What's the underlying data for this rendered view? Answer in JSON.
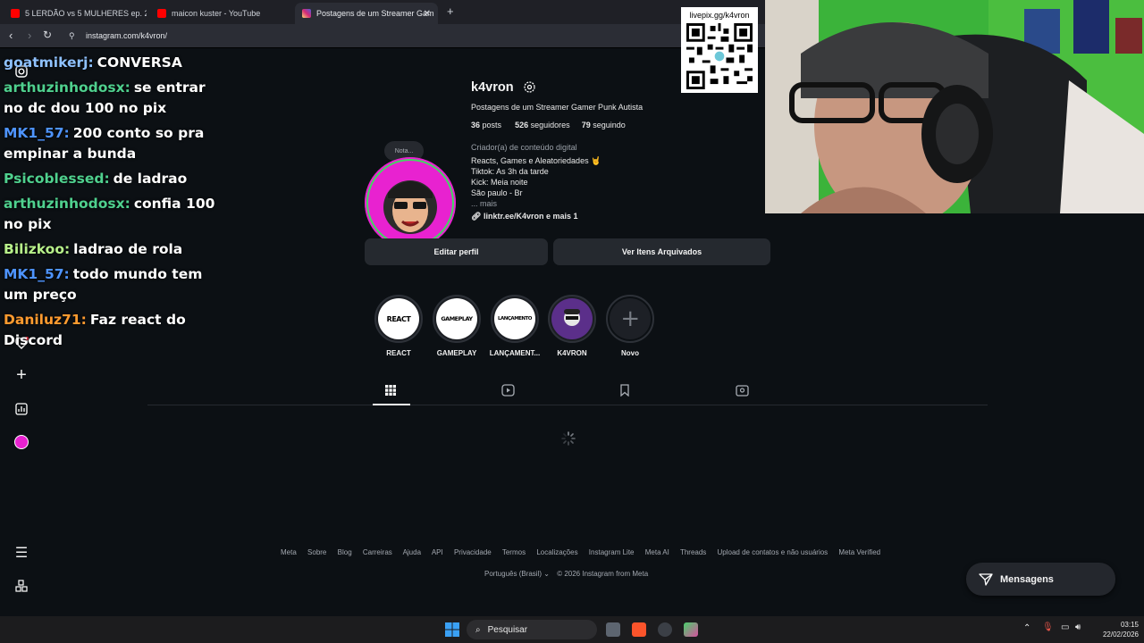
{
  "browser": {
    "tabs": [
      {
        "title": "5 LERDÃO vs 5 MULHERES ep. 2 - You",
        "icon": "youtube-icon",
        "color": "#ff0000"
      },
      {
        "title": "maicon kuster - YouTube",
        "icon": "youtube-icon",
        "color": "#ff0000"
      },
      {
        "title": "Postagens de um Streamer Gam",
        "icon": "instagram-icon",
        "color": "#dd2a7b"
      }
    ],
    "url": "instagram.com/k4vron/"
  },
  "chat": [
    {
      "user": "goatmikerj:",
      "message": "CONVERSA",
      "color": "#8fc2ff"
    },
    {
      "user": "arthuzinhodosx:",
      "message": "se entrar no dc dou 100 no pix",
      "color": "#4fd08e"
    },
    {
      "user": "MK1_57:",
      "message": "200 conto so pra empinar a bunda",
      "color": "#4e94ff"
    },
    {
      "user": "Psicoblessed:",
      "message": "de ladrao",
      "color": "#4fd08e"
    },
    {
      "user": "arthuzinhodosx:",
      "message": "confia 100 no pix",
      "color": "#4fd08e"
    },
    {
      "user": "Bilizkoo:",
      "message": "ladrao de rola",
      "color": "#b7f08a"
    },
    {
      "user": "MK1_57:",
      "message": "todo mundo tem um preço",
      "color": "#4e94ff"
    },
    {
      "user": "Daniluz71:",
      "message": "Faz react do Discord",
      "color": "#ff9b2f"
    }
  ],
  "profile": {
    "note": "Nota...",
    "username": "k4vron",
    "bio_title": "Postagens de um Streamer Gamer Punk Autista",
    "stats": {
      "posts": "36",
      "posts_label": "posts",
      "followers": "526",
      "followers_label": "seguidores",
      "following": "79",
      "following_label": "seguindo"
    },
    "category": "Criador(a) de conteúdo digital",
    "bio_lines": [
      "Reacts, Games e Aleatoriedades 🤘",
      "Tiktok: As 3h da tarde",
      "Kick: Meia noite",
      "São paulo - Br"
    ],
    "more": "... mais",
    "link": "linktr.ee/K4vron e mais 1",
    "edit_button": "Editar perfil",
    "archive_button": "Ver Itens Arquivados"
  },
  "highlights": [
    {
      "label": "REACT",
      "art": "REACT"
    },
    {
      "label": "GAMEPLAY",
      "art": "GAMEPLAY"
    },
    {
      "label": "LANÇAMENT...",
      "art": "LANÇAMENTO"
    },
    {
      "label": "K4VRON",
      "art": ""
    },
    {
      "label": "Novo",
      "art": "+"
    }
  ],
  "footer": {
    "links": [
      "Meta",
      "Sobre",
      "Blog",
      "Carreiras",
      "Ajuda",
      "API",
      "Privacidade",
      "Termos",
      "Localizações",
      "Instagram Lite",
      "Meta AI",
      "Threads",
      "Upload de contatos e não usuários",
      "Meta Verified"
    ],
    "language": "Português (Brasil)",
    "copyright": "© 2026 Instagram from Meta"
  },
  "messages_button": "Mensagens",
  "qr_label": "livepix.gg/k4vron",
  "taskbar": {
    "search": "Pesquisar",
    "time": "03:15",
    "date": "22/02/2026"
  },
  "colors": {
    "accent": "#0095f6",
    "bg": "#0c1014",
    "button": "#25292f"
  }
}
